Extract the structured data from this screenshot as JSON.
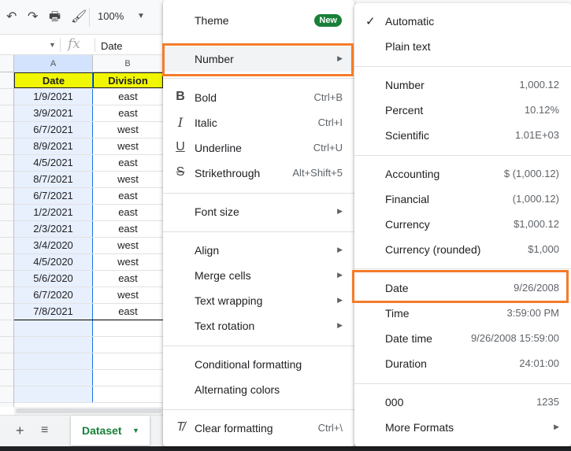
{
  "toolbar": {
    "zoom": "100%"
  },
  "formula_bar": {
    "value": "Date"
  },
  "grid": {
    "columns": [
      "A",
      "B"
    ],
    "header": {
      "a": "Date",
      "b": "Division"
    },
    "rows": [
      {
        "date": "1/9/2021",
        "division": "east"
      },
      {
        "date": "3/9/2021",
        "division": "east"
      },
      {
        "date": "6/7/2021",
        "division": "west"
      },
      {
        "date": "8/9/2021",
        "division": "west"
      },
      {
        "date": "4/5/2021",
        "division": "east"
      },
      {
        "date": "8/7/2021",
        "division": "west"
      },
      {
        "date": "6/7/2021",
        "division": "east"
      },
      {
        "date": "1/2/2021",
        "division": "east"
      },
      {
        "date": "2/3/2021",
        "division": "east"
      },
      {
        "date": "3/4/2020",
        "division": "west"
      },
      {
        "date": "4/5/2020",
        "division": "west"
      },
      {
        "date": "5/6/2020",
        "division": "east"
      },
      {
        "date": "6/7/2020",
        "division": "west"
      },
      {
        "date": "7/8/2021",
        "division": "east"
      }
    ]
  },
  "sheet_tab": {
    "name": "Dataset"
  },
  "format_menu": {
    "theme": "Theme",
    "new_badge": "New",
    "number": "Number",
    "bold": {
      "label": "Bold",
      "shortcut": "Ctrl+B"
    },
    "italic": {
      "label": "Italic",
      "shortcut": "Ctrl+I"
    },
    "underline": {
      "label": "Underline",
      "shortcut": "Ctrl+U"
    },
    "strikethrough": {
      "label": "Strikethrough",
      "shortcut": "Alt+Shift+5"
    },
    "font_size": "Font size",
    "align": "Align",
    "merge_cells": "Merge cells",
    "text_wrapping": "Text wrapping",
    "text_rotation": "Text rotation",
    "conditional_formatting": "Conditional formatting",
    "alternating_colors": "Alternating colors",
    "clear_formatting": {
      "label": "Clear formatting",
      "shortcut": "Ctrl+\\"
    }
  },
  "number_menu": {
    "automatic": "Automatic",
    "plain_text": "Plain text",
    "number": {
      "label": "Number",
      "example": "1,000.12"
    },
    "percent": {
      "label": "Percent",
      "example": "10.12%"
    },
    "scientific": {
      "label": "Scientific",
      "example": "1.01E+03"
    },
    "accounting": {
      "label": "Accounting",
      "example": "$ (1,000.12)"
    },
    "financial": {
      "label": "Financial",
      "example": "(1,000.12)"
    },
    "currency": {
      "label": "Currency",
      "example": "$1,000.12"
    },
    "currency_rounded": {
      "label": "Currency (rounded)",
      "example": "$1,000"
    },
    "date": {
      "label": "Date",
      "example": "9/26/2008"
    },
    "time": {
      "label": "Time",
      "example": "3:59:00 PM"
    },
    "date_time": {
      "label": "Date time",
      "example": "9/26/2008 15:59:00"
    },
    "duration": {
      "label": "Duration",
      "example": "24:01:00"
    },
    "custom_000": {
      "label": "000",
      "example": "1235"
    },
    "more_formats": "More Formats"
  },
  "colors": {
    "highlight": "#f47c2a",
    "header_fill": "#f1f700",
    "new_badge": "#188038"
  }
}
